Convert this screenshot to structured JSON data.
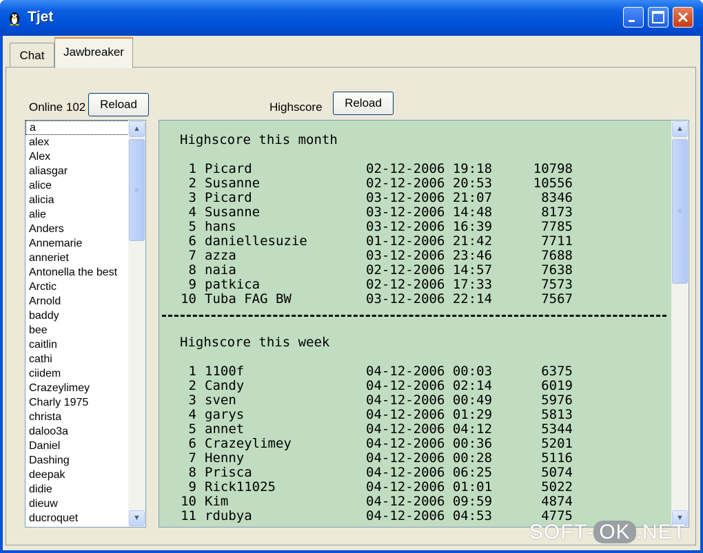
{
  "window": {
    "title": "Tjet",
    "minimize_icon": "minimize-icon",
    "maximize_icon": "maximize-icon",
    "close_icon": "close-icon"
  },
  "tabs": [
    {
      "label": "Chat",
      "active": false
    },
    {
      "label": "Jawbreaker",
      "active": true
    }
  ],
  "online": {
    "label": "Online 102",
    "reload_label": "Reload",
    "users": [
      "a",
      "alex",
      "Alex",
      "aliasgar",
      "alice",
      "alicia",
      "alie",
      "Anders",
      "Annemarie",
      "anneriet",
      "Antonella the best",
      "Arctic",
      "Arnold",
      "baddy",
      "bee",
      "caitlin",
      "cathi",
      "ciidem",
      "Crazeylimey",
      "Charly 1975",
      "christa",
      "daloo3a",
      "Daniel",
      "Dashing",
      "deepak",
      "didie",
      "dieuw",
      "ducroquet"
    ]
  },
  "highscore": {
    "label": "Highscore",
    "reload_label": "Reload",
    "month_heading": "Highscore this month",
    "month": [
      {
        "rank": "1",
        "name": "Picard",
        "date": "02-12-2006 19:18",
        "score": "10798"
      },
      {
        "rank": "2",
        "name": "Susanne",
        "date": "02-12-2006 20:53",
        "score": "10556"
      },
      {
        "rank": "3",
        "name": "Picard",
        "date": "03-12-2006 21:07",
        "score": "8346"
      },
      {
        "rank": "4",
        "name": "Susanne",
        "date": "03-12-2006 14:48",
        "score": "8173"
      },
      {
        "rank": "5",
        "name": "hans",
        "date": "03-12-2006 16:39",
        "score": "7785"
      },
      {
        "rank": "6",
        "name": "daniellesuzie",
        "date": "01-12-2006 21:42",
        "score": "7711"
      },
      {
        "rank": "7",
        "name": "azza",
        "date": "03-12-2006 23:46",
        "score": "7688"
      },
      {
        "rank": "8",
        "name": "naia",
        "date": "02-12-2006 14:57",
        "score": "7638"
      },
      {
        "rank": "9",
        "name": "patkica",
        "date": "02-12-2006 17:33",
        "score": "7573"
      },
      {
        "rank": "10",
        "name": "Tuba FAG BW",
        "date": "03-12-2006 22:14",
        "score": "7567"
      }
    ],
    "week_heading": "Highscore this week",
    "week": [
      {
        "rank": "1",
        "name": "1100f",
        "date": "04-12-2006 00:03",
        "score": "6375"
      },
      {
        "rank": "2",
        "name": "Candy",
        "date": "04-12-2006 02:14",
        "score": "6019"
      },
      {
        "rank": "3",
        "name": "sven",
        "date": "04-12-2006 00:49",
        "score": "5976"
      },
      {
        "rank": "4",
        "name": "garys",
        "date": "04-12-2006 01:29",
        "score": "5813"
      },
      {
        "rank": "5",
        "name": "annet",
        "date": "04-12-2006 04:12",
        "score": "5344"
      },
      {
        "rank": "6",
        "name": "Crazeylimey",
        "date": "04-12-2006 00:36",
        "score": "5201"
      },
      {
        "rank": "7",
        "name": "Henny",
        "date": "04-12-2006 00:28",
        "score": "5116"
      },
      {
        "rank": "8",
        "name": "Prisca",
        "date": "04-12-2006 06:25",
        "score": "5074"
      },
      {
        "rank": "9",
        "name": "Rick11025",
        "date": "04-12-2006 01:01",
        "score": "5022"
      },
      {
        "rank": "10",
        "name": "Kim",
        "date": "04-12-2006 09:59",
        "score": "4874"
      },
      {
        "rank": "11",
        "name": "rdubya",
        "date": "04-12-2006 04:53",
        "score": "4775"
      }
    ]
  },
  "watermark": {
    "left": "SOFT-",
    "ok": "OK",
    "right": ".NET"
  },
  "colors": {
    "title_bar": "#0050d8",
    "highscore_bg": "#c1ddc1",
    "panel_bg": "#ece9d8"
  }
}
